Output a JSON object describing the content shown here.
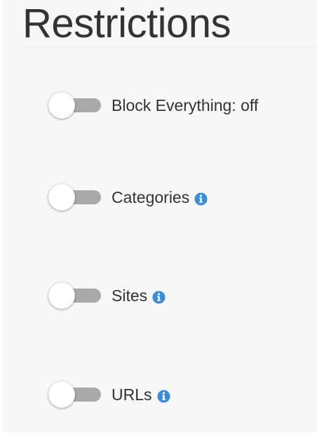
{
  "page": {
    "title": "Restrictions"
  },
  "restrictions": [
    {
      "label": "Block Everything: off",
      "enabled": false,
      "has_info": false
    },
    {
      "label": "Categories",
      "enabled": false,
      "has_info": true
    },
    {
      "label": "Sites",
      "enabled": false,
      "has_info": true
    },
    {
      "label": "URLs",
      "enabled": false,
      "has_info": true
    }
  ],
  "icons": {
    "info": "info-circle-icon"
  },
  "colors": {
    "toggle_track_off": "#a9a9a9",
    "info_icon": "#3a8dde",
    "text": "#333333"
  }
}
